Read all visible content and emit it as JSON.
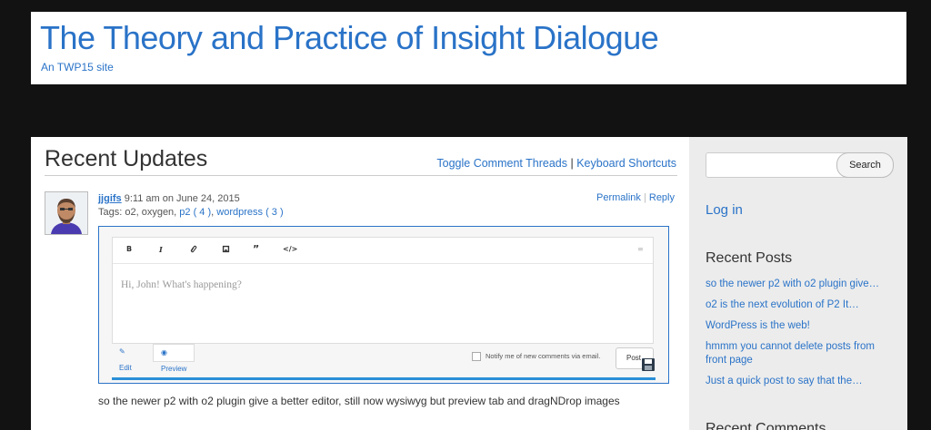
{
  "site": {
    "title": "The Theory and Practice of Insight Dialogue",
    "description": "An TWP15 site"
  },
  "main": {
    "heading": "Recent Updates",
    "toggle_link": "Toggle Comment Threads",
    "separator": "|",
    "shortcuts_link": "Keyboard Shortcuts"
  },
  "post": {
    "author": "jjgifs",
    "time": "9:11 am on June 24, 2015",
    "tags_label": "Tags:",
    "tags_plain": "o2, oxygen,",
    "tag1": "p2 ( 4 )",
    "tag_sep": ",",
    "tag2": "wordpress ( 3 )",
    "permalink": "Permalink",
    "action_sep": "|",
    "reply": "Reply",
    "body": "so the newer p2 with o2 plugin give a better editor, still now wysiwyg but preview tab and dragNDrop images"
  },
  "editor": {
    "toolbar": {
      "bold": "B",
      "italic": "I",
      "link": "🔗",
      "image": "▣",
      "quote": "”",
      "code": "</>",
      "more": "≡"
    },
    "placeholder": "Hi, John! What's happening?",
    "edit_tab": "Edit",
    "preview_tab": "Preview",
    "notify_label": "Notify me of new comments via email.",
    "post_button": "Post",
    "upload_progress": 1.0
  },
  "sidebar": {
    "search_button": "Search",
    "search_value": "",
    "login_link": "Log in",
    "recent_posts_heading": "Recent Posts",
    "recent_posts": [
      "so the newer p2 with o2 plugin give…",
      "o2 is the next evolution of P2 It…",
      "WordPress is the web!",
      "hmmm you cannot delete posts from front page",
      "Just a quick post to say that the…"
    ],
    "recent_comments_heading": "Recent Comments"
  },
  "colors": {
    "link": "#2a73c8",
    "page_bg": "#121212",
    "sidebar_bg": "#ececec",
    "progress": "#2a8fd8"
  }
}
